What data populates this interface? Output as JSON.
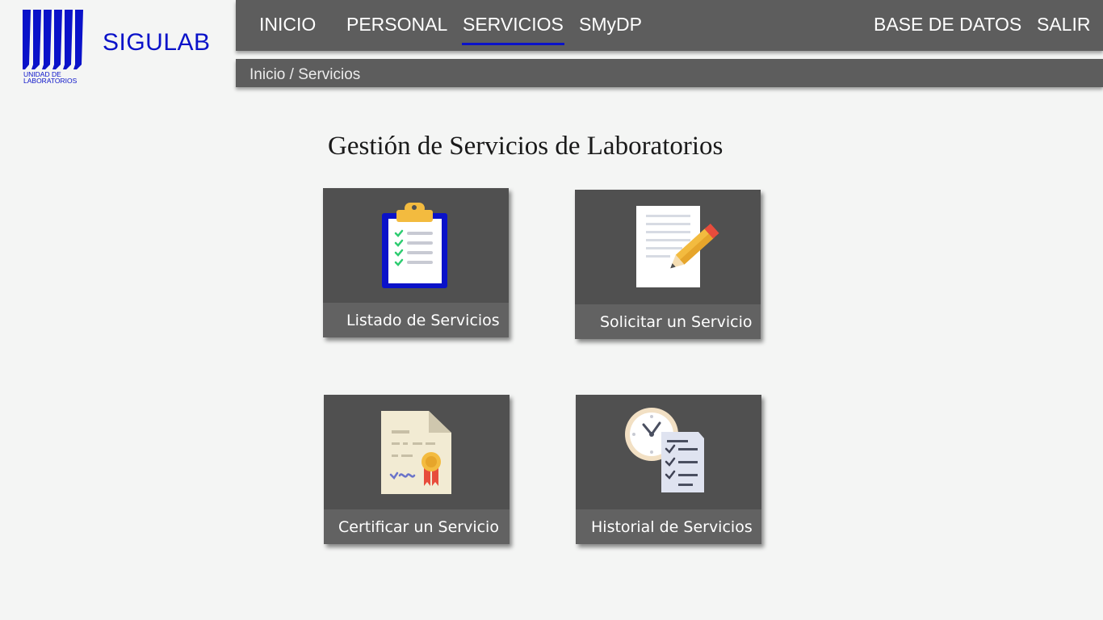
{
  "brand": {
    "logo_line1": "UNIDAD DE",
    "logo_line2": "LABORATORIOS",
    "name": "SIGULAB",
    "color": "#0a12c9"
  },
  "nav": {
    "items": [
      {
        "label": "INICIO",
        "active": false
      },
      {
        "label": "PERSONAL",
        "active": false
      },
      {
        "label": "SERVICIOS",
        "active": true
      },
      {
        "label": "SMyDP",
        "active": false
      }
    ],
    "right_items": [
      {
        "label": "BASE DE DATOS"
      },
      {
        "label": "SALIR"
      }
    ],
    "background": "#5d5d5d",
    "active_underline": "#0a12c9"
  },
  "breadcrumb": {
    "home": "Inicio",
    "separator": " / ",
    "current": "Servicios"
  },
  "main": {
    "title": "Gestión de Servicios de Laboratorios",
    "tiles": [
      {
        "label": "Listado de Servicios",
        "icon": "clipboard-checklist-icon"
      },
      {
        "label": "Solicitar un Servicio",
        "icon": "document-pencil-icon"
      },
      {
        "label": "Certificar un Servicio",
        "icon": "certificate-icon"
      },
      {
        "label": "Historial de Servicios",
        "icon": "clock-checklist-icon"
      }
    ]
  }
}
